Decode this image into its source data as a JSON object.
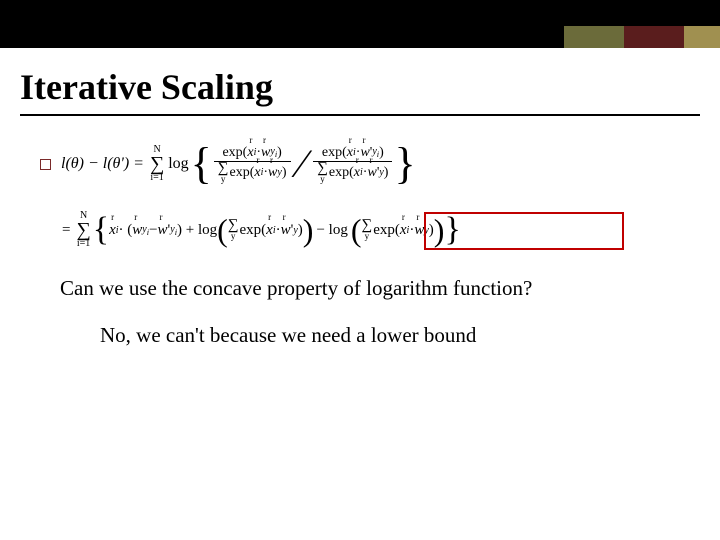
{
  "title": "Iterative Scaling",
  "eq1": {
    "lhs": "l(θ) − l(θ') =",
    "sum_top": "N",
    "sum_bot": "i=1",
    "log": "log",
    "frac1_num": "exp(xᵢ · w_yᵢ)",
    "frac1_den_sum": "y",
    "frac1_den": "exp(xᵢ · w_y)",
    "frac2_num": "exp(xᵢ · w'_yᵢ)",
    "frac2_den_sum": "y",
    "frac2_den": "exp(xᵢ · w'_y)"
  },
  "eq2": {
    "eq": "=",
    "sum_top": "N",
    "sum_bot": "i=1",
    "term1": "xᵢ · (w_yᵢ − w'_yᵢ) + log",
    "inner1_sum": "y",
    "inner1": "exp(xᵢ · w'_y)",
    "minus_log": "− log",
    "inner2_sum": "y",
    "inner2": "exp(xᵢ · w_y)"
  },
  "question": "Can we use the concave property of logarithm function?",
  "answer": "No, we can't because we need a lower bound"
}
